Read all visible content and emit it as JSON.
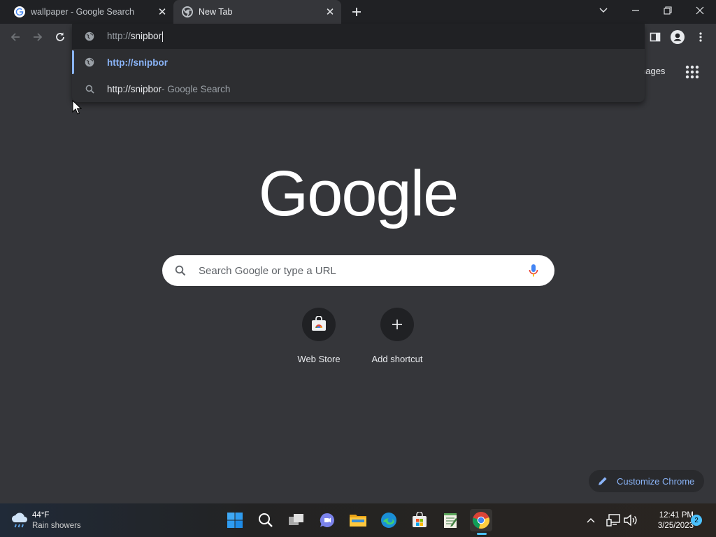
{
  "tabs": [
    {
      "title": "wallpaper - Google Search",
      "active": false
    },
    {
      "title": "New Tab",
      "active": true
    }
  ],
  "omnibox": {
    "typed_prefix": "http://",
    "typed_rest": "snipbor",
    "suggestions": [
      {
        "text": "http://snipbor",
        "suffix": "",
        "icon": "globe-icon",
        "selected": true
      },
      {
        "text": "http://snipbor",
        "suffix": " - Google Search",
        "icon": "search-icon",
        "selected": false
      }
    ]
  },
  "ntp": {
    "top_link": "nages",
    "logo_text": "Google",
    "search_placeholder": "Search Google or type a URL",
    "shortcuts": [
      {
        "label": "Web Store",
        "icon": "web-store-icon"
      },
      {
        "label": "Add shortcut",
        "icon": "plus-icon"
      }
    ],
    "customize_label": "Customize Chrome"
  },
  "taskbar": {
    "weather_temp": "44°F",
    "weather_desc": "Rain showers",
    "time": "12:41 PM",
    "date": "3/25/2023",
    "notification_count": "2"
  },
  "colors": {
    "accent": "#8ab4f8",
    "frame": "#202124",
    "background": "#35363a"
  }
}
